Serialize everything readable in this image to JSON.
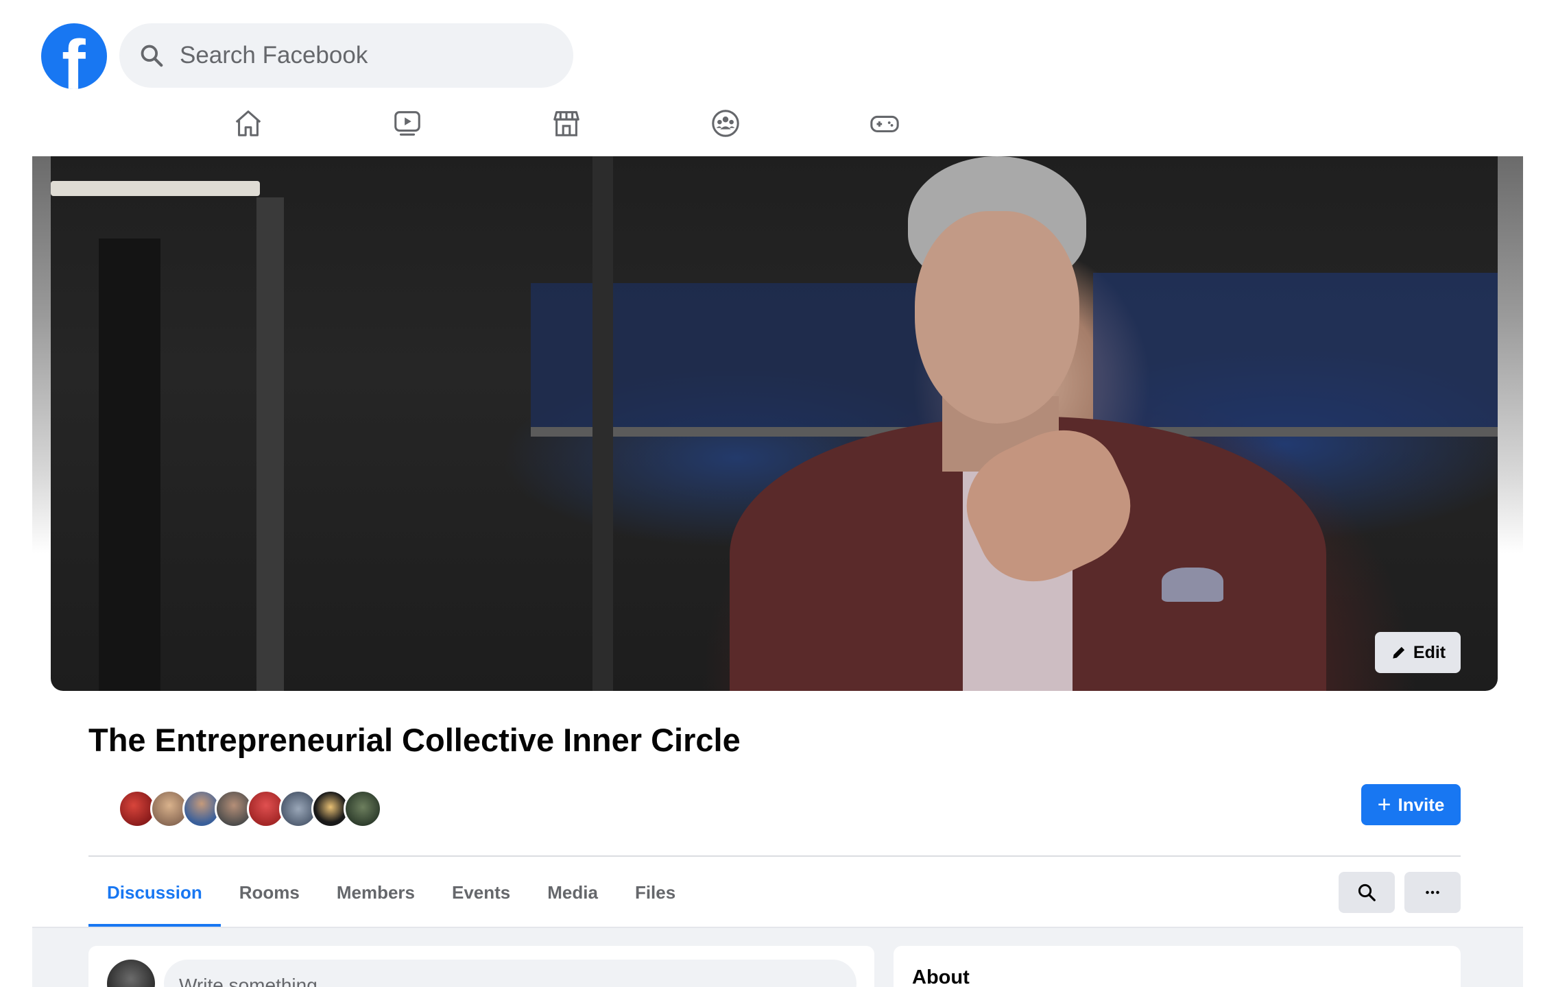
{
  "header": {
    "logo_letter": "f",
    "search_placeholder": "Search Facebook",
    "nav_icons": [
      "home-icon",
      "watch-icon",
      "marketplace-icon",
      "groups-icon",
      "gaming-icon"
    ]
  },
  "cover": {
    "edit_label": "Edit"
  },
  "group": {
    "title": "The Entrepreneurial Collective Inner Circle",
    "member_avatar_count": 8,
    "invite_label": "Invite"
  },
  "tabs": [
    {
      "label": "Discussion",
      "active": true
    },
    {
      "label": "Rooms",
      "active": false
    },
    {
      "label": "Members",
      "active": false
    },
    {
      "label": "Events",
      "active": false
    },
    {
      "label": "Media",
      "active": false
    },
    {
      "label": "Files",
      "active": false
    }
  ],
  "composer": {
    "placeholder": "Write something"
  },
  "about": {
    "heading": "About"
  },
  "colors": {
    "brand_blue": "#1877f2",
    "secondary_text": "#65676b",
    "button_gray": "#e4e6eb",
    "feed_bg": "#f0f2f5"
  }
}
